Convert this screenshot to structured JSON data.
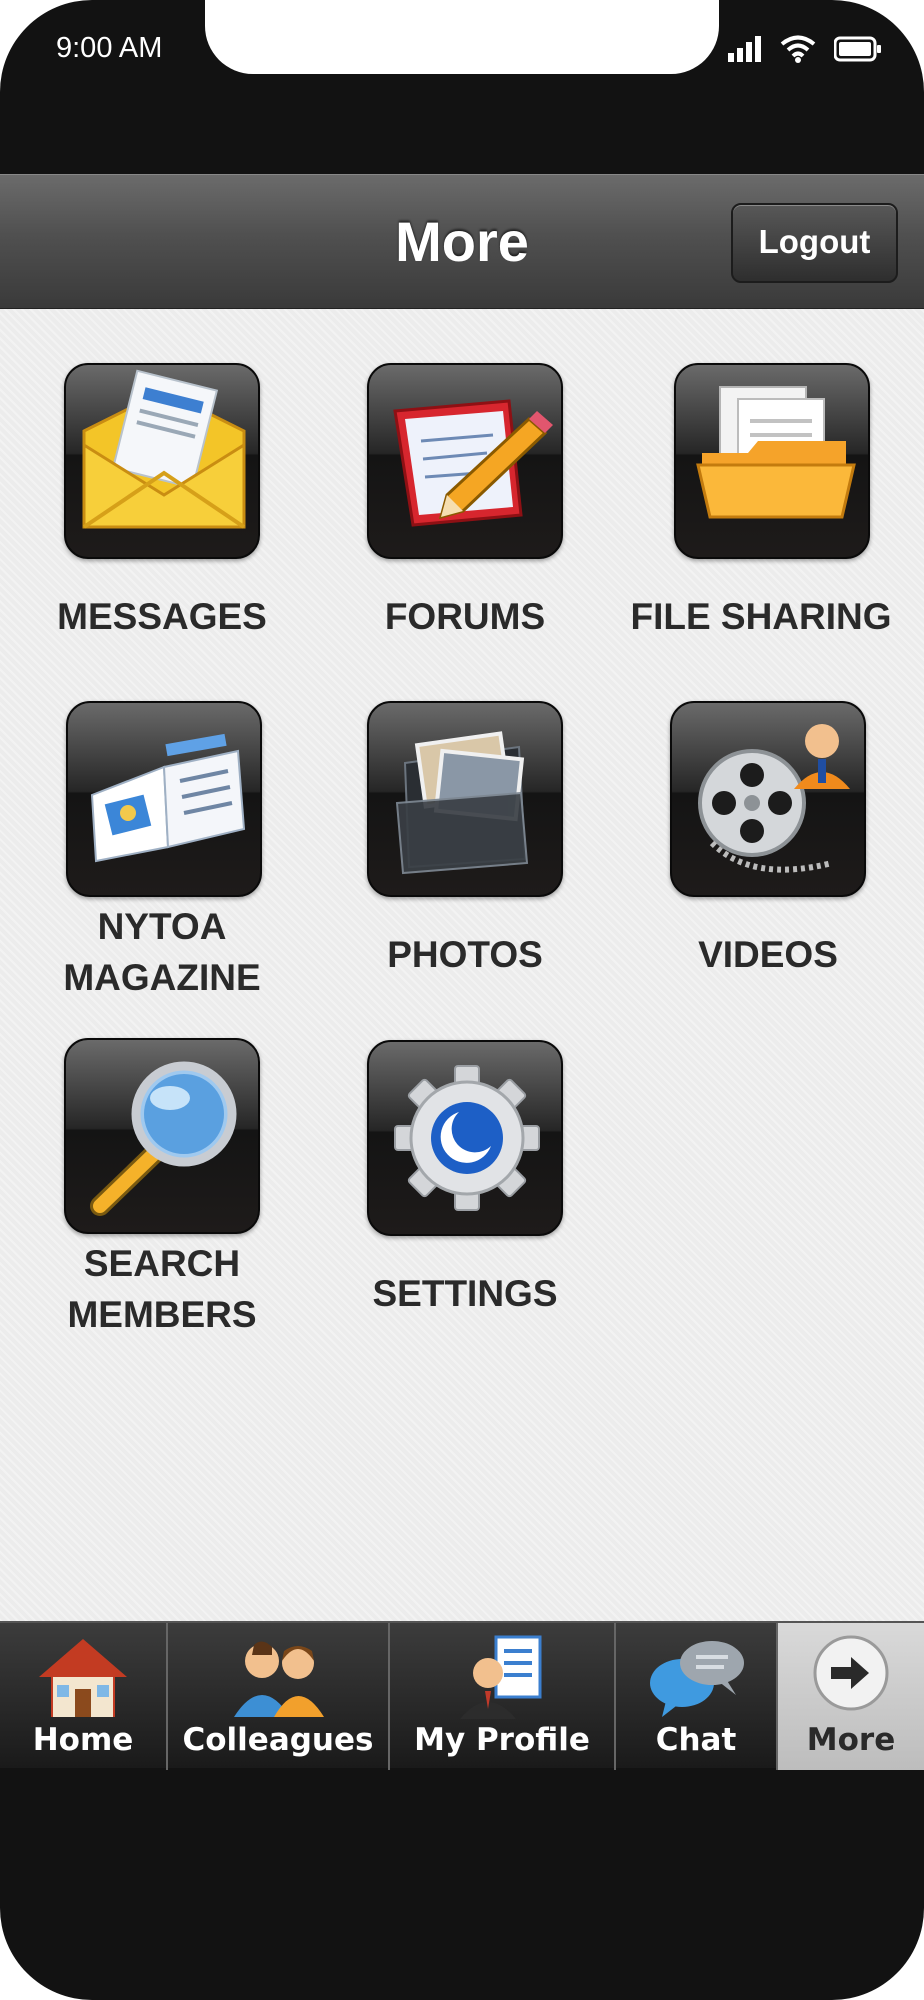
{
  "status_bar": {
    "time": "9:00 AM"
  },
  "header": {
    "title": "More",
    "logout_label": "Logout"
  },
  "grid": {
    "items": [
      {
        "label": "MESSAGES",
        "icon": "envelope-icon"
      },
      {
        "label": "FORUMS",
        "icon": "notepad-pencil-icon"
      },
      {
        "label": "FILE SHARING",
        "icon": "folder-icon"
      },
      {
        "label_line1": "NYTOA",
        "label_line2": "MAGAZINE",
        "icon": "magazine-icon"
      },
      {
        "label": "PHOTOS",
        "icon": "photos-icon"
      },
      {
        "label": "VIDEOS",
        "icon": "film-reel-icon"
      },
      {
        "label_line1": "SEARCH",
        "label_line2": "MEMBERS",
        "icon": "magnifier-icon"
      },
      {
        "label": "SETTINGS",
        "icon": "gear-icon"
      }
    ]
  },
  "tab_bar": {
    "active": "More",
    "tabs": [
      {
        "label": "Home",
        "icon": "house-icon"
      },
      {
        "label": "Colleagues",
        "icon": "people-icon"
      },
      {
        "label": "My Profile",
        "icon": "profile-icon"
      },
      {
        "label": "Chat",
        "icon": "chat-bubbles-icon"
      },
      {
        "label": "More",
        "icon": "arrow-right-icon"
      }
    ]
  },
  "colors": {
    "header": "#505050",
    "content_bg": "#ececec",
    "label_text": "#2a2a2a",
    "tab_bar": "#2a2a2a",
    "active_tab": "#cfcfcf"
  }
}
